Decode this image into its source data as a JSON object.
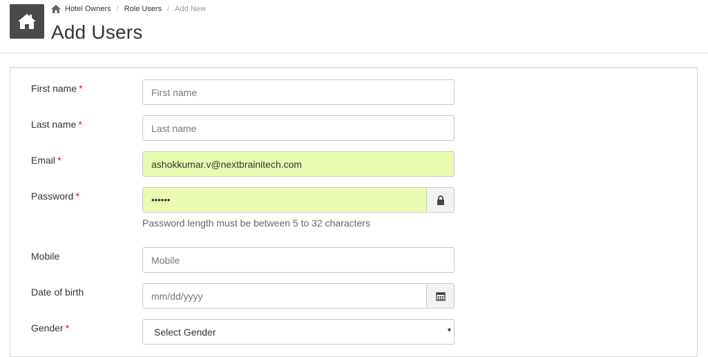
{
  "breadcrumb": {
    "items": [
      "Hotel Owners",
      "Role Users"
    ],
    "active": "Add New",
    "separator": "/"
  },
  "page": {
    "title": "Add Users"
  },
  "form": {
    "first_name": {
      "label": "First name",
      "required": "*",
      "placeholder": "First name"
    },
    "last_name": {
      "label": "Last name",
      "required": "*",
      "placeholder": "Last name"
    },
    "email": {
      "label": "Email",
      "required": "*",
      "value": "ashokkumar.v@nextbrainitech.com"
    },
    "password": {
      "label": "Password",
      "required": "*",
      "value": "••••••",
      "help": "Password length must be between 5 to 32 characters",
      "icon": "lock-icon"
    },
    "mobile": {
      "label": "Mobile",
      "placeholder": "Mobile"
    },
    "dob": {
      "label": "Date of birth",
      "placeholder": "mm/dd/yyyy",
      "icon": "calendar-icon"
    },
    "gender": {
      "label": "Gender",
      "required": "*",
      "selected": "Select Gender"
    }
  },
  "colors": {
    "autofill": "#e8fbb0",
    "required": "#d9001b",
    "home_tile": "#4a4a4a"
  }
}
